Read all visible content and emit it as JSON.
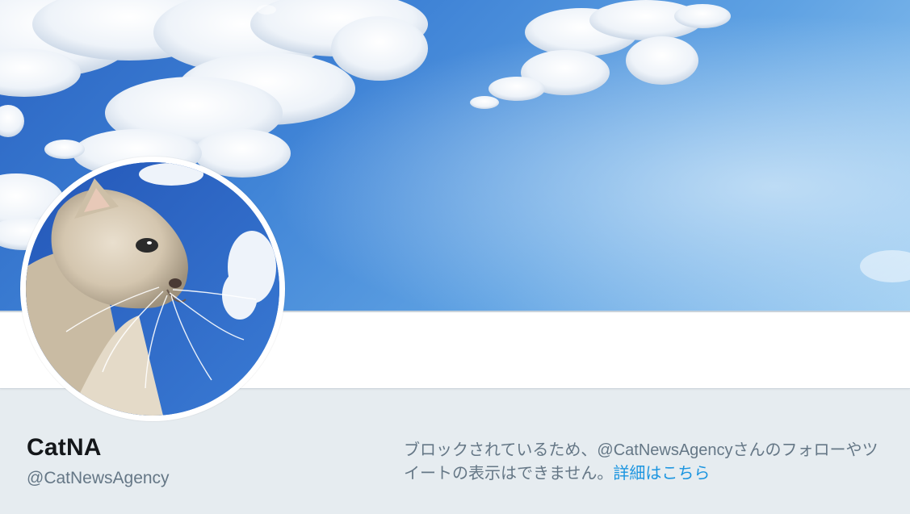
{
  "header": {
    "banner_image": "sky-with-clouds-banner"
  },
  "profile": {
    "avatar": "cat-avatar",
    "name": "CatNA",
    "handle": "@CatNewsAgency"
  },
  "notice": {
    "line1": "ブロックされているため、@CatNewsAgencyさんのフォローやツ",
    "line2_prefix": "イートの表示はできません。",
    "link_label": "詳細はこちら"
  },
  "colors": {
    "link": "#1b95e0",
    "secondary_text": "#657786",
    "primary_text": "#14171a",
    "page_background": "#e6ecf0"
  }
}
